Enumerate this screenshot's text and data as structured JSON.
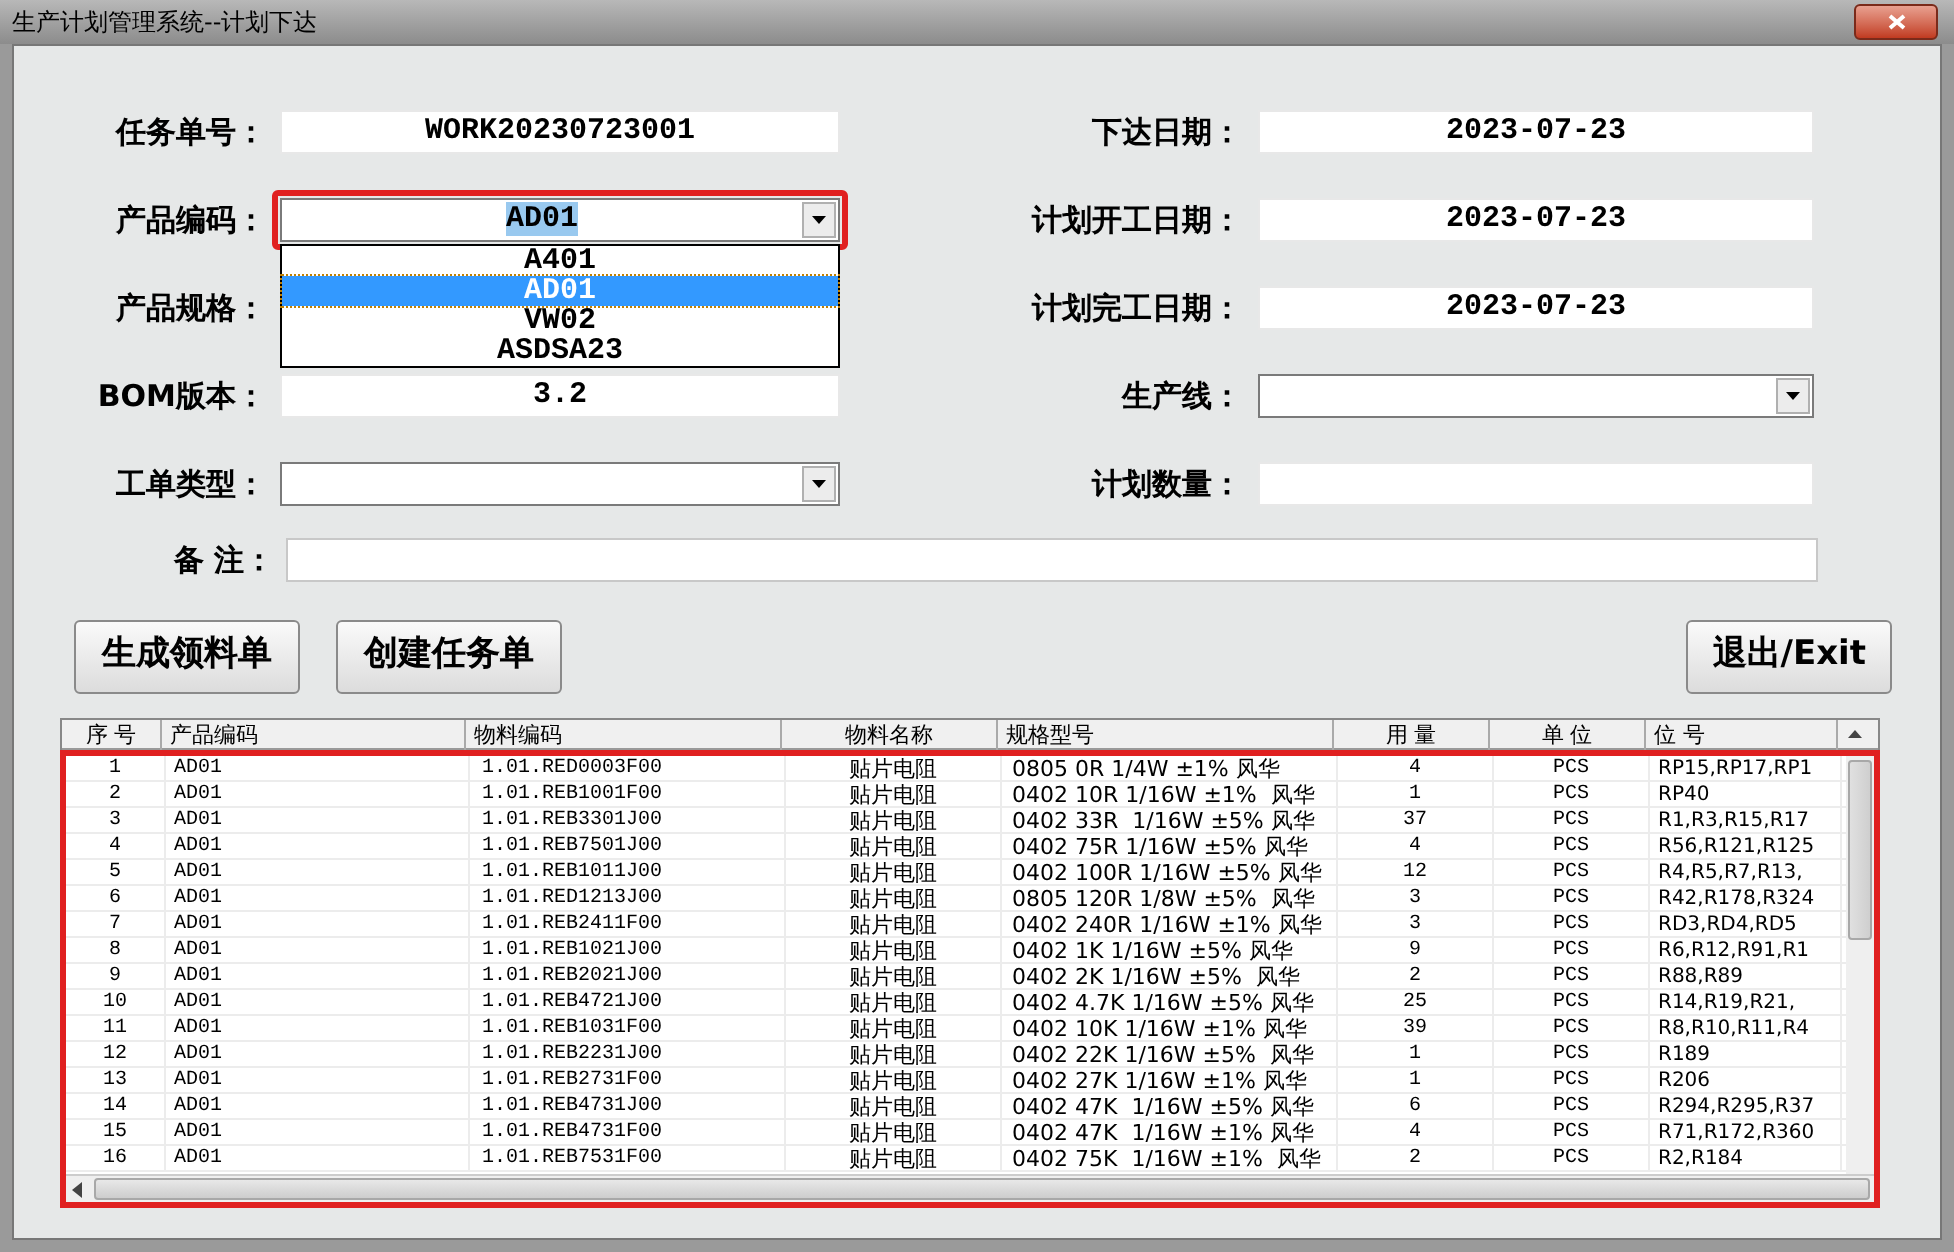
{
  "window": {
    "title": "生产计划管理系统--计划下达"
  },
  "form_rows": [
    {
      "left": {
        "label": "任务单号：",
        "kind": "text",
        "value": "WORK20230723001"
      },
      "right": {
        "label": "下达日期：",
        "kind": "text",
        "value": "2023-07-23"
      }
    },
    {
      "left": {
        "label": "产品编码：",
        "kind": "combo",
        "value": "AD01",
        "highlighted": true,
        "options": [
          {
            "label": "A401",
            "selected": false
          },
          {
            "label": "AD01",
            "selected": true
          },
          {
            "label": "VW02",
            "selected": false
          },
          {
            "label": "ASDSA23",
            "selected": false
          }
        ]
      },
      "right": {
        "label": "计划开工日期：",
        "kind": "text",
        "value": "2023-07-23"
      }
    },
    {
      "left": {
        "label": "产品规格：",
        "kind": "text"
      },
      "right": {
        "label": "计划完工日期：",
        "kind": "text",
        "value": "2023-07-23"
      }
    },
    {
      "left": {
        "label": "BOM版本：",
        "kind": "text",
        "value": "3.2"
      },
      "right": {
        "label": "生产线：",
        "kind": "combo"
      }
    },
    {
      "left": {
        "label": "工单类型：",
        "kind": "combo"
      },
      "right": {
        "label": "计划数量：",
        "kind": "text"
      }
    }
  ],
  "remark": {
    "label": "备 注："
  },
  "buttons": [
    "生成领料单",
    "创建任务单"
  ],
  "exit_button": "退出/Exit",
  "table": {
    "columns": [
      "序 号",
      "产品编码",
      "物料编码",
      "物料名称",
      "规格型号",
      "用 量",
      "单 位",
      "位 号"
    ],
    "rows": [
      [
        "1",
        "AD01",
        "1.01.RED0003F00",
        "贴片电阻",
        "0805 0R 1/4W ±1% 风华",
        "4",
        "PCS",
        "RP15,RP17,RP1"
      ],
      [
        "2",
        "AD01",
        "1.01.REB1001F00",
        "贴片电阻",
        "0402 10R 1/16W ±1%  风华",
        "1",
        "PCS",
        "RP40"
      ],
      [
        "3",
        "AD01",
        "1.01.REB3301J00",
        "贴片电阻",
        "0402 33R  1/16W ±5% 风华",
        "37",
        "PCS",
        "R1,R3,R15,R17"
      ],
      [
        "4",
        "AD01",
        "1.01.REB7501J00",
        "贴片电阻",
        "0402 75R 1/16W ±5% 风华",
        "4",
        "PCS",
        "R56,R121,R125"
      ],
      [
        "5",
        "AD01",
        "1.01.REB1011J00",
        "贴片电阻",
        "0402 100R 1/16W ±5% 风华",
        "12",
        "PCS",
        "R4,R5,R7,R13,"
      ],
      [
        "6",
        "AD01",
        "1.01.RED1213J00",
        "贴片电阻",
        "0805 120R 1/8W ±5%  风华",
        "3",
        "PCS",
        "R42,R178,R324"
      ],
      [
        "7",
        "AD01",
        "1.01.REB2411F00",
        "贴片电阻",
        "0402 240R 1/16W ±1% 风华",
        "3",
        "PCS",
        "RD3,RD4,RD5"
      ],
      [
        "8",
        "AD01",
        "1.01.REB1021J00",
        "贴片电阻",
        "0402 1K 1/16W ±5% 风华",
        "9",
        "PCS",
        "R6,R12,R91,R1"
      ],
      [
        "9",
        "AD01",
        "1.01.REB2021J00",
        "贴片电阻",
        "0402 2K 1/16W ±5%  风华",
        "2",
        "PCS",
        "R88,R89"
      ],
      [
        "10",
        "AD01",
        "1.01.REB4721J00",
        "贴片电阻",
        "0402 4.7K 1/16W ±5% 风华",
        "25",
        "PCS",
        "R14,R19,R21,"
      ],
      [
        "11",
        "AD01",
        "1.01.REB1031F00",
        "贴片电阻",
        "0402 10K 1/16W ±1% 风华",
        "39",
        "PCS",
        "R8,R10,R11,R4"
      ],
      [
        "12",
        "AD01",
        "1.01.REB2231J00",
        "贴片电阻",
        "0402 22K 1/16W ±5%  风华",
        "1",
        "PCS",
        "R189"
      ],
      [
        "13",
        "AD01",
        "1.01.REB2731F00",
        "贴片电阻",
        "0402 27K 1/16W ±1% 风华",
        "1",
        "PCS",
        "R206"
      ],
      [
        "14",
        "AD01",
        "1.01.REB4731J00",
        "贴片电阻",
        "0402 47K  1/16W ±5% 风华",
        "6",
        "PCS",
        "R294,R295,R37"
      ],
      [
        "15",
        "AD01",
        "1.01.REB4731F00",
        "贴片电阻",
        "0402 47K  1/16W ±1% 风华",
        "4",
        "PCS",
        "R71,R172,R360"
      ],
      [
        "16",
        "AD01",
        "1.01.REB7531F00",
        "贴片电阻",
        "0402 75K  1/16W ±1%  风华",
        "2",
        "PCS",
        "R2,R184"
      ]
    ]
  }
}
